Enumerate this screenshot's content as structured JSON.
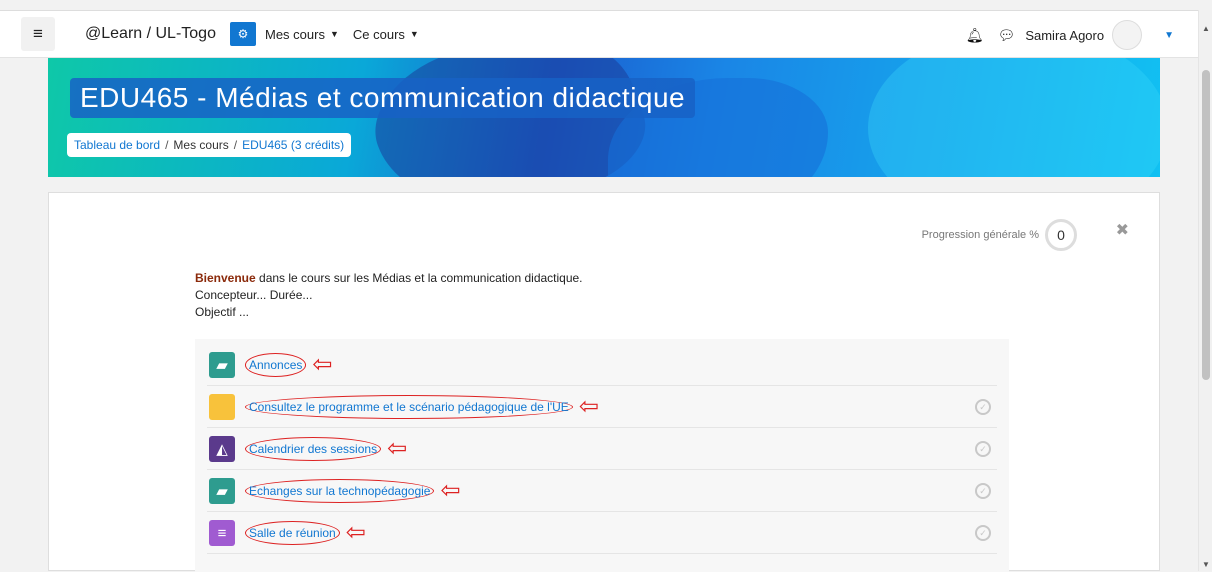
{
  "topbar": {
    "site_name": "@Learn / UL-Togo",
    "menu_my_courses": "Mes cours",
    "menu_this_course": "Ce cours",
    "user_name": "Samira Agoro"
  },
  "course": {
    "title": "EDU465 - Médias et communication didactique",
    "breadcrumb": [
      "Tableau de bord",
      "Mes cours",
      "EDU465 (3 crédits)"
    ]
  },
  "progress": {
    "label": "Progression générale %",
    "value": "0"
  },
  "summary": {
    "welcome_word": "Bienvenue",
    "welcome_rest": " dans le cours sur les Médias et la communication didactique.",
    "line2": "Concepteur... Durée...",
    "line3": "Objectif ..."
  },
  "activities": [
    {
      "label": "Annonces",
      "icon": "forum-icon",
      "color": "#2e9c8f",
      "completion": false
    },
    {
      "label": "Consultez le programme et le scénario pédagogique de l'UE",
      "icon": "folder-icon",
      "color": "#f8c23b",
      "completion": true
    },
    {
      "label": "Calendrier des sessions",
      "icon": "image-icon",
      "color": "#5b3a8c",
      "completion": true
    },
    {
      "label": "Echanges sur la technopédagogie",
      "icon": "forum-icon",
      "color": "#2e9c8f",
      "completion": true
    },
    {
      "label": "Salle de réunion",
      "icon": "chat-icon",
      "color": "#a05bd1",
      "completion": true
    }
  ]
}
